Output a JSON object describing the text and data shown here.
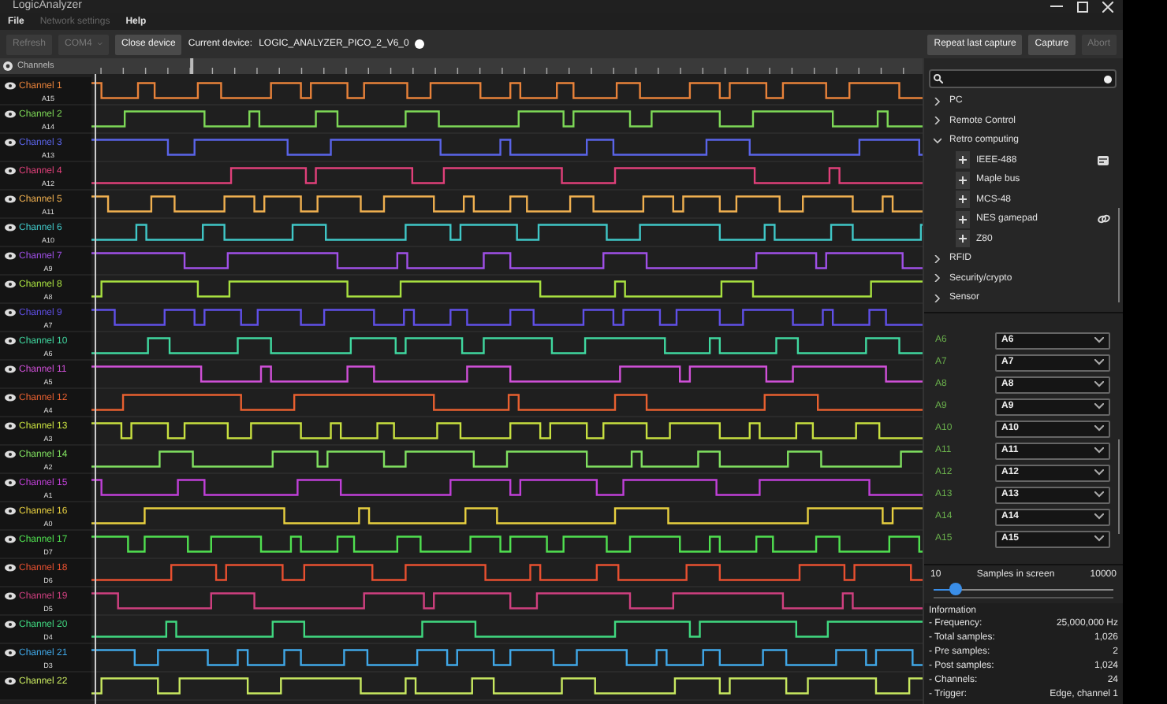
{
  "window": {
    "title": "LogicAnalyzer"
  },
  "menu": [
    {
      "label": "File",
      "disabled": false
    },
    {
      "label": "Network settings",
      "disabled": true
    },
    {
      "label": "Help",
      "disabled": false
    }
  ],
  "toolbar": {
    "left": [
      {
        "kind": "button",
        "label": "Refresh",
        "disabled": true
      },
      {
        "kind": "dropdown",
        "label": "COM4",
        "disabled": true
      },
      {
        "kind": "button",
        "label": "Close device",
        "disabled": false
      }
    ],
    "device_label": "Current device:",
    "device_name": "LOGIC_ANALYZER_PICO_2_V6_0",
    "right": [
      {
        "label": "Repeat last capture",
        "disabled": false
      },
      {
        "label": "Capture",
        "disabled": false
      },
      {
        "label": "Abort",
        "disabled": true
      }
    ]
  },
  "channels_header": {
    "label": "Channels"
  },
  "channels": [
    {
      "name": "Channel 1",
      "pin": "A15",
      "color": "#e8823a"
    },
    {
      "name": "Channel 2",
      "pin": "A14",
      "color": "#7ed957"
    },
    {
      "name": "Channel 3",
      "pin": "A13",
      "color": "#5a64e8"
    },
    {
      "name": "Channel 4",
      "pin": "A12",
      "color": "#e0407a"
    },
    {
      "name": "Channel 5",
      "pin": "A11",
      "color": "#f0b050"
    },
    {
      "name": "Channel 6",
      "pin": "A10",
      "color": "#40c8c8"
    },
    {
      "name": "Channel 7",
      "pin": "A9",
      "color": "#a050e8"
    },
    {
      "name": "Channel 8",
      "pin": "A8",
      "color": "#a8e040"
    },
    {
      "name": "Channel 9",
      "pin": "A7",
      "color": "#6050e8"
    },
    {
      "name": "Channel 10",
      "pin": "A6",
      "color": "#40d8a0"
    },
    {
      "name": "Channel 11",
      "pin": "A5",
      "color": "#d050d8"
    },
    {
      "name": "Channel 12",
      "pin": "A4",
      "color": "#e86030"
    },
    {
      "name": "Channel 13",
      "pin": "A3",
      "color": "#c8e040"
    },
    {
      "name": "Channel 14",
      "pin": "A2",
      "color": "#80e060"
    },
    {
      "name": "Channel 15",
      "pin": "A1",
      "color": "#c040d8"
    },
    {
      "name": "Channel 16",
      "pin": "A0",
      "color": "#e8d040"
    },
    {
      "name": "Channel 17",
      "pin": "D7",
      "color": "#50e050"
    },
    {
      "name": "Channel 18",
      "pin": "D6",
      "color": "#e85030"
    },
    {
      "name": "Channel 19",
      "pin": "D5",
      "color": "#d04080"
    },
    {
      "name": "Channel 20",
      "pin": "D4",
      "color": "#40d880"
    },
    {
      "name": "Channel 21",
      "pin": "D3",
      "color": "#40a8e8"
    },
    {
      "name": "Channel 22",
      "color": "#c8e860"
    }
  ],
  "protocols": [
    {
      "label": "PC",
      "expanded": false
    },
    {
      "label": "Remote Control",
      "expanded": false
    },
    {
      "label": "Retro computing",
      "expanded": true,
      "children": [
        {
          "label": "IEEE-488",
          "kind": "document"
        },
        {
          "label": "Maple bus",
          "kind": "plain"
        },
        {
          "label": "MCS-48",
          "kind": "plain"
        },
        {
          "label": "NES gamepad",
          "kind": "link"
        },
        {
          "label": "Z80",
          "kind": "plain"
        }
      ]
    },
    {
      "label": "RFID",
      "expanded": false
    },
    {
      "label": "Security/crypto",
      "expanded": false
    },
    {
      "label": "Sensor",
      "expanded": false
    }
  ],
  "mapping": [
    {
      "label": "A6",
      "value": "A6"
    },
    {
      "label": "A7",
      "value": "A7"
    },
    {
      "label": "A8",
      "value": "A8"
    },
    {
      "label": "A9",
      "value": "A9"
    },
    {
      "label": "A10",
      "value": "A10"
    },
    {
      "label": "A11",
      "value": "A11"
    },
    {
      "label": "A12",
      "value": "A12"
    },
    {
      "label": "A13",
      "value": "A13"
    },
    {
      "label": "A14",
      "value": "A14"
    },
    {
      "label": "A15",
      "value": "A15"
    }
  ],
  "samples": {
    "min": "10",
    "label": "Samples in screen",
    "max": "10000",
    "level": 0.12
  },
  "information": {
    "title": "Information",
    "rows": [
      {
        "label": "- Frequency:",
        "value": "25,000,000 Hz"
      },
      {
        "label": "- Total samples:",
        "value": "1,026"
      },
      {
        "label": "- Pre samples:",
        "value": "2"
      },
      {
        "label": "- Post samples:",
        "value": "1,024"
      },
      {
        "label": "- Channels:",
        "value": "24"
      },
      {
        "label": "- Trigger:",
        "value": "Edge, channel 1"
      }
    ]
  }
}
